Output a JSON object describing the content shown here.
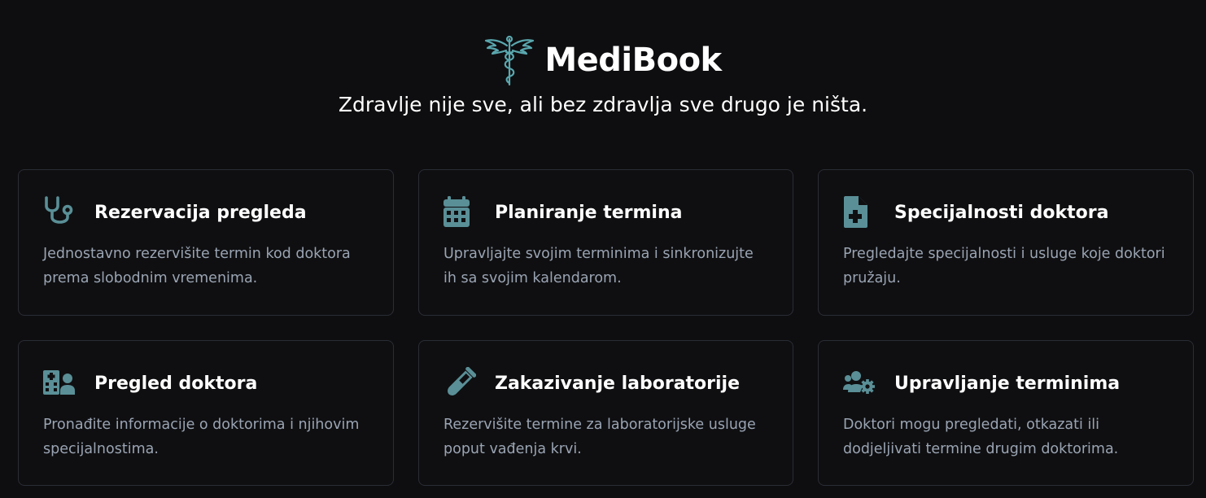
{
  "brand": {
    "name": "MediBook",
    "logo_icon": "caduceus-icon",
    "accent_color": "#5aa7ae"
  },
  "tagline": "Zdravlje nije sve, ali bez zdravlja sve drugo je ništa.",
  "colors": {
    "background": "#0e0e10",
    "card_border": "#2a2d36",
    "icon": "#5a8f97",
    "title": "#ffffff",
    "description": "#9aa4b3"
  },
  "features": [
    {
      "icon": "stethoscope-icon",
      "title": "Rezervacija pregleda",
      "description": "Jednostavno rezervišite termin kod doktora prema slobodnim vremenima."
    },
    {
      "icon": "calendar-icon",
      "title": "Planiranje termina",
      "description": "Upravljajte svojim terminima i sinkronizujte ih sa svojim kalendarom."
    },
    {
      "icon": "medical-file-icon",
      "title": "Specijalnosti doktora",
      "description": "Pregledajte specijalnosti i usluge koje doktori pružaju."
    },
    {
      "icon": "hospital-user-icon",
      "title": "Pregled doktora",
      "description": "Pronađite informacije o doktorima i njihovim specijalnostima."
    },
    {
      "icon": "test-tube-icon",
      "title": "Zakazivanje laboratorije",
      "description": "Rezervišite termine za laboratorijske usluge poput vađenja krvi."
    },
    {
      "icon": "users-cog-icon",
      "title": "Upravljanje terminima",
      "description": "Doktori mogu pregledati, otkazati ili dodjeljivati termine drugim doktorima."
    }
  ]
}
